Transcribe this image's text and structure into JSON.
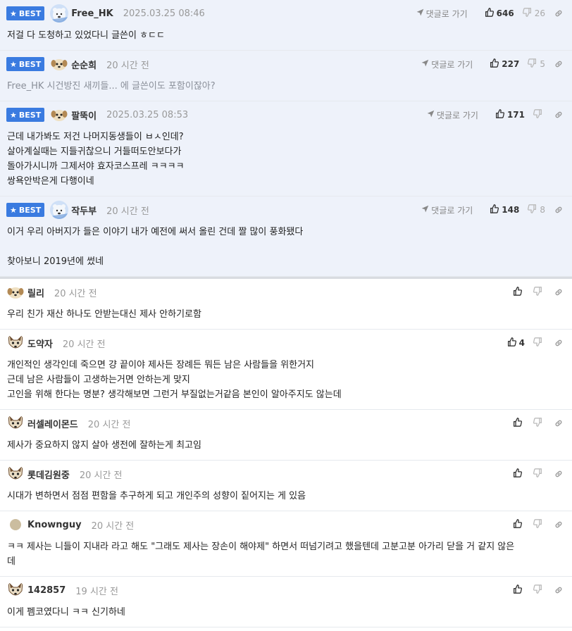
{
  "ui": {
    "best_label": "BEST",
    "reply_label": "댓글로 가기"
  },
  "best_comments": [
    {
      "nick": "Free_HK",
      "time": "2025.03.25 08:46",
      "up": "646",
      "down": "26",
      "avatar": "polar-bear-avatar",
      "lines": [
        "저걸 다 도청하고 있었다니 글쓴이 ㅎㄷㄷ"
      ]
    },
    {
      "nick": "순순희",
      "time": "20 시간 전",
      "up": "227",
      "down": "5",
      "avatar": "puppy-avatar",
      "quote": "Free_HK 시건방진 새끼들... 에 글쓴이도 포함이잖아?",
      "lines": []
    },
    {
      "nick": "팔뚝이",
      "time": "2025.03.25 08:53",
      "up": "171",
      "down": "",
      "avatar": "puppy-avatar",
      "lines": [
        "근데 내가봐도 저건 나머지동생들이 ㅂㅅ인데?",
        "살아계실때는 지들귀찮으니 거들떠도안보다가",
        "돌아가시니까 그제서야 효자코스프레 ㅋㅋㅋㅋ",
        "쌍욕안박은게 다행이네"
      ]
    },
    {
      "nick": "작두부",
      "time": "20 시간 전",
      "up": "148",
      "down": "8",
      "avatar": "polar-bear-avatar",
      "lines": [
        "이거 우리 아버지가 들은 이야기 내가 예전에 써서 올린 건데 짤 많이 풍화됐다",
        "",
        "찾아보니 2019년에 썼네"
      ]
    }
  ],
  "comments": [
    {
      "nick": "릴리",
      "time": "20 시간 전",
      "up": "",
      "avatar": "puppy-avatar",
      "lines": [
        "우리 친가 재산 하나도 안받는대신 제사 안하기로함"
      ]
    },
    {
      "nick": "도약자",
      "time": "20 시간 전",
      "up": "4",
      "avatar": "fox-avatar",
      "lines": [
        "개인적인 생각인데 죽으면 걍 끝이야 제사든 장례든 뭐든 남은 사람들을 위한거지",
        "근데 남은 사람들이 고생하는거면 안하는게 맞지",
        "고인을 위해 한다는 명분? 생각해보면 그런거 부질없는거같음 본인이 알아주지도 않는데"
      ]
    },
    {
      "nick": "러셀레이몬드",
      "time": "20 시간 전",
      "up": "",
      "avatar": "fox-avatar",
      "lines": [
        "제사가 중요하지 않지 살아 생전에 잘하는게 최고임"
      ]
    },
    {
      "nick": "롯데김원중",
      "time": "20 시간 전",
      "up": "",
      "avatar": "fox-avatar",
      "lines": [
        "시대가 변하면서 점점 편함을 추구하게 되고 개인주의 성향이 짙어지는 게 있음"
      ]
    },
    {
      "nick": "Knowngu y",
      "time": "20 시간 전",
      "up": "",
      "avatar": "default-avatar",
      "lines": [
        "ㅋㅋ 제사는 니들이 지내라 라고 해도 \"그래도 제사는 장손이 해야제\" 하면서 떠넘기려고 했을텐데 고분고분 아가리 닫을 거 같지 않은",
        "데"
      ]
    },
    {
      "nick": "142857",
      "time": "19 시간 전",
      "up": "",
      "avatar": "fox-avatar",
      "lines": [
        "이게 펨코였다니 ㅋㅋ 신기하네"
      ]
    }
  ]
}
